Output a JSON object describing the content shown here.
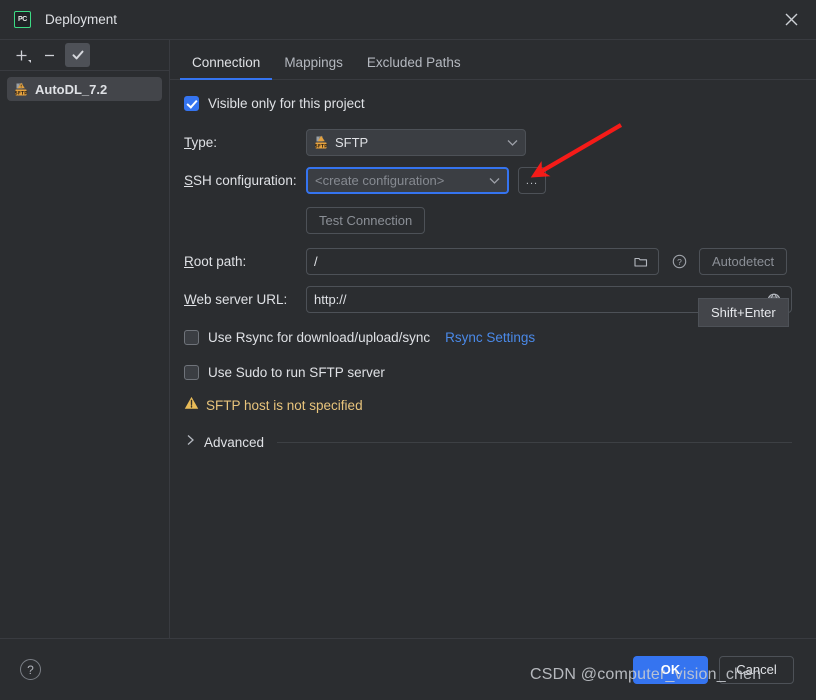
{
  "window": {
    "title": "Deployment",
    "app_icon": "pycharm-icon",
    "close_icon": "close-icon"
  },
  "sidebar": {
    "toolbar": [
      {
        "name": "add-button",
        "glyph": "+"
      },
      {
        "name": "remove-button",
        "glyph": "−"
      },
      {
        "name": "use-as-default-button",
        "glyph": "✓"
      }
    ],
    "items": [
      {
        "label": "AutoDL_7.2",
        "icon": "sftp-server-icon",
        "selected": true
      }
    ]
  },
  "tabs": [
    {
      "label": "Connection",
      "active": true
    },
    {
      "label": "Mappings",
      "active": false
    },
    {
      "label": "Excluded Paths",
      "active": false
    }
  ],
  "form": {
    "visible_only_checkbox": {
      "label": "Visible only for this project",
      "checked": true
    },
    "type": {
      "label": "Type:",
      "label_mnemonic": "T",
      "value": "SFTP",
      "icon": "sftp-icon",
      "chevron": "chevron-down-icon"
    },
    "ssh_configuration": {
      "label": "SSH configuration:",
      "label_mnemonic": "S",
      "value": "<create configuration>",
      "is_placeholder": true,
      "focused": true,
      "chevron": "chevron-down-icon",
      "browse_button": "...",
      "browse_icon": "ellipsis-icon"
    },
    "test_connection": {
      "label": "Test Connection",
      "enabled": false
    },
    "tooltip": {
      "text": "Shift+Enter"
    },
    "root_path": {
      "label": "Root path:",
      "label_mnemonic": "R",
      "value": "/",
      "browse_icon": "folder-icon",
      "help_icon": "question-circle-icon",
      "autodetect_label": "Autodetect",
      "autodetect_enabled": false
    },
    "web_server_url": {
      "label": "Web server URL:",
      "label_mnemonic": "W",
      "value": "http://",
      "open_icon": "globe-icon"
    },
    "rsync": {
      "label": "Use Rsync for download/upload/sync",
      "checked": false,
      "link_label": "Rsync Settings"
    },
    "sudo": {
      "label": "Use Sudo to run SFTP server",
      "checked": false
    },
    "warning": {
      "icon": "warning-triangle-icon",
      "text": "SFTP host is not specified",
      "color": "#e8c47c"
    },
    "advanced": {
      "label": "Advanced",
      "chevron": "chevron-right-icon",
      "expanded": false
    }
  },
  "footer": {
    "help_icon": "question-mark-icon",
    "ok_label": "OK",
    "cancel_label": "Cancel"
  },
  "annotation": {
    "arrow_color": "#f51b18",
    "points_to": "ssh-configuration-browse-button"
  },
  "watermark": {
    "text": "CSDN @computer_vision_chen"
  },
  "colors": {
    "accent": "#3574f0",
    "background": "#2b2d30",
    "panel": "#3b3e43",
    "warning": "#e8c47c",
    "link": "#4a89e8"
  }
}
